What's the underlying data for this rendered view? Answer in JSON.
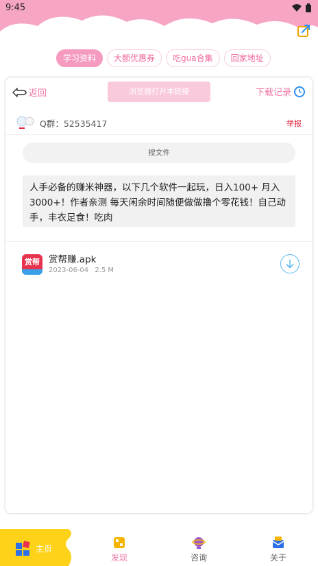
{
  "status_bar": {
    "time": "9:45"
  },
  "tabs": [
    {
      "label": "学习资料",
      "active": true
    },
    {
      "label": "大额优惠券",
      "active": false
    },
    {
      "label": "吃gua合集",
      "active": false
    },
    {
      "label": "回家地址",
      "active": false
    }
  ],
  "nav": {
    "back_label": "返回",
    "open_browser_label": "浏览器打开本链接",
    "download_record_label": "下载记录"
  },
  "group": {
    "qq_group": "Q群：52535417",
    "report_label": "举报"
  },
  "search": {
    "label": "搜文件"
  },
  "description": "人手必备的赚米神器，以下几个软件一起玩，日入100+ 月入3000+！作者亲测 每天闲余时间随便做做撸个零花钱！自己动手，丰衣足食！吃肉",
  "file": {
    "icon_text": "赏帮",
    "name": "赏帮赚.apk",
    "date": "2023-06-04",
    "size": "2.5 M"
  },
  "bottom_nav": [
    {
      "label": "主页",
      "icon": "home-icon"
    },
    {
      "label": "发现",
      "icon": "discover-icon"
    },
    {
      "label": "咨询",
      "icon": "consult-icon"
    },
    {
      "label": "关于",
      "icon": "about-icon"
    }
  ],
  "colors": {
    "accent_pink": "#f59bc0",
    "header_pink": "#f6a6c4",
    "report_red": "#e0233c",
    "download_blue": "#5ab6f2",
    "home_yellow": "#ffd21a"
  }
}
